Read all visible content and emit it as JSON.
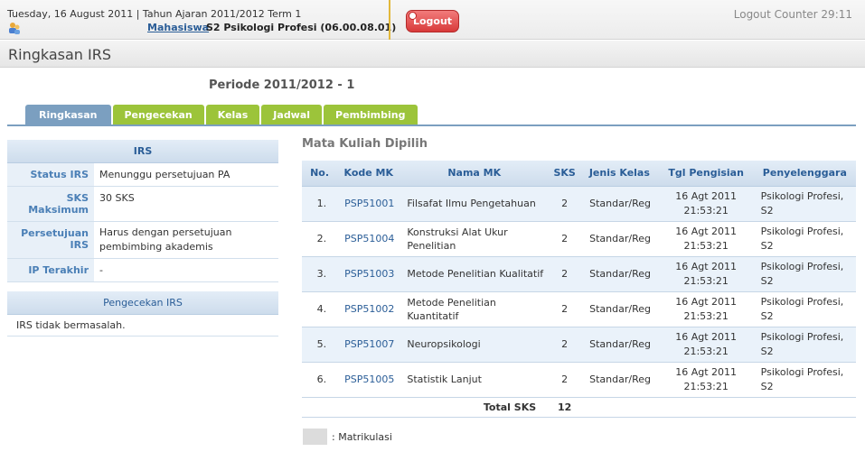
{
  "header": {
    "date_line": "Tuesday, 16 August 2011 | Tahun Ajaran 2011/2012 Term 1",
    "role_link": "Mahasiswa",
    "program": "S2 Psikologi Profesi (06.00.08.01)",
    "logout_label": "Logout",
    "logout_counter": "Logout Counter 29:11",
    "icons": {
      "user": "user-group-icon",
      "logout": "power-icon"
    }
  },
  "page": {
    "title": "Ringkasan IRS",
    "periode": "Periode 2011/2012 - 1"
  },
  "tabs": [
    {
      "label": "Ringkasan"
    },
    {
      "label": "Pengecekan"
    },
    {
      "label": "Kelas"
    },
    {
      "label": "Jadwal"
    },
    {
      "label": "Pembimbing"
    }
  ],
  "irs": {
    "heading": "IRS",
    "rows": [
      {
        "key": "Status IRS",
        "value": "Menunggu persetujuan PA"
      },
      {
        "key": "SKS Maksimum",
        "value": "30 SKS"
      },
      {
        "key": "Persetujuan IRS",
        "value": "Harus dengan persetujuan pembimbing akademis"
      },
      {
        "key": "IP Terakhir",
        "value": "-"
      }
    ]
  },
  "pengecekan": {
    "heading": "Pengecekan IRS",
    "body": "IRS tidak bermasalah."
  },
  "mata_kuliah": {
    "title": "Mata Kuliah Dipilih",
    "columns": [
      "No.",
      "Kode MK",
      "Nama MK",
      "SKS",
      "Jenis Kelas",
      "Tgl Pengisian",
      "Penyelenggara"
    ],
    "rows": [
      {
        "no": "1.",
        "kode": "PSP51001",
        "nama": "Filsafat Ilmu Pengetahuan",
        "sks": "2",
        "jenis": "Standar/Reg",
        "tgl": "16 Agt 2011 21:53:21",
        "peny": "Psikologi Profesi, S2"
      },
      {
        "no": "2.",
        "kode": "PSP51004",
        "nama": "Konstruksi Alat Ukur Penelitian",
        "sks": "2",
        "jenis": "Standar/Reg",
        "tgl": "16 Agt 2011 21:53:21",
        "peny": "Psikologi Profesi, S2"
      },
      {
        "no": "3.",
        "kode": "PSP51003",
        "nama": "Metode Penelitian Kualitatif",
        "sks": "2",
        "jenis": "Standar/Reg",
        "tgl": "16 Agt 2011 21:53:21",
        "peny": "Psikologi Profesi, S2"
      },
      {
        "no": "4.",
        "kode": "PSP51002",
        "nama": "Metode Penelitian Kuantitatif",
        "sks": "2",
        "jenis": "Standar/Reg",
        "tgl": "16 Agt 2011 21:53:21",
        "peny": "Psikologi Profesi, S2"
      },
      {
        "no": "5.",
        "kode": "PSP51007",
        "nama": "Neuropsikologi",
        "sks": "2",
        "jenis": "Standar/Reg",
        "tgl": "16 Agt 2011 21:53:21",
        "peny": "Psikologi Profesi, S2"
      },
      {
        "no": "6.",
        "kode": "PSP51005",
        "nama": "Statistik Lanjut",
        "sks": "2",
        "jenis": "Standar/Reg",
        "tgl": "16 Agt 2011 21:53:21",
        "peny": "Psikologi Profesi, S2"
      }
    ],
    "total_label": "Total SKS",
    "total_value": "12"
  },
  "legend": {
    "label": ": Matrikulasi",
    "swatch_color": "#dcdcdc"
  },
  "colors": {
    "tab_active": "#7b9fc0",
    "tab_inactive": "#9cc43a",
    "logout": "#d83a3a",
    "link": "#2a5d97"
  }
}
